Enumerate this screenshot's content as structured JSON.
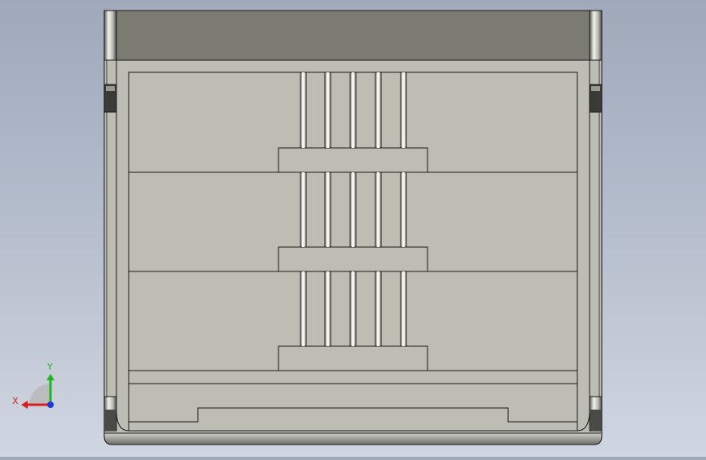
{
  "viewport": {
    "background_top": "#9fa9ba",
    "background_bottom": "#d0d6e1"
  },
  "model": {
    "body_color": "#bdbdb4",
    "edge_color": "#1a1a1a",
    "top_band_color": "#7b7b72",
    "post_light": "#e8e8e2",
    "post_dark": "#4a4a46"
  },
  "triad": {
    "x_label": "X",
    "y_label": "Y",
    "x_color": "#d61f1f",
    "y_color": "#1fb51f",
    "z_color": "#1f3bd6"
  }
}
